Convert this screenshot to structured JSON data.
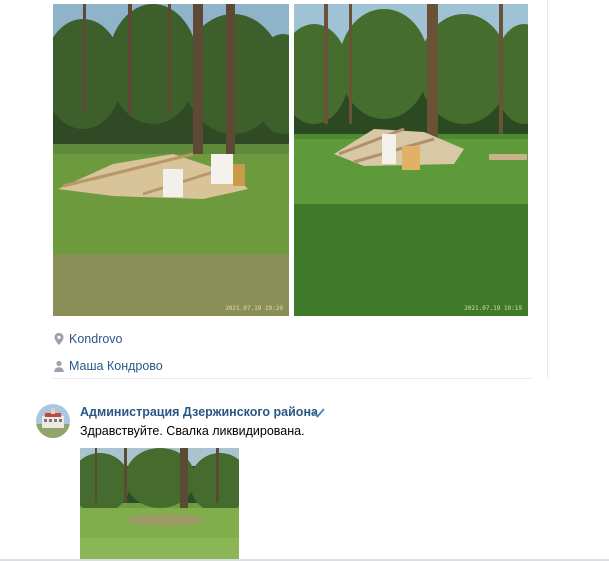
{
  "post": {
    "photos": [
      {
        "stamp": "2021.07.19 19:20"
      },
      {
        "stamp": "2021.07.19 19:19"
      }
    ],
    "location": {
      "icon": "location-pin-icon",
      "label": "Kondrovo"
    },
    "author": {
      "icon": "person-icon",
      "label": "Маша Кондрово"
    }
  },
  "reply": {
    "author": "Администрация Дзержинского района",
    "verified_icon": "verified-check-icon",
    "text": "Здравствуйте. Свалка ликвидирована."
  },
  "colors": {
    "link": "#2a5885",
    "divider": "#e7e8ec",
    "verified": "#5181b8"
  }
}
